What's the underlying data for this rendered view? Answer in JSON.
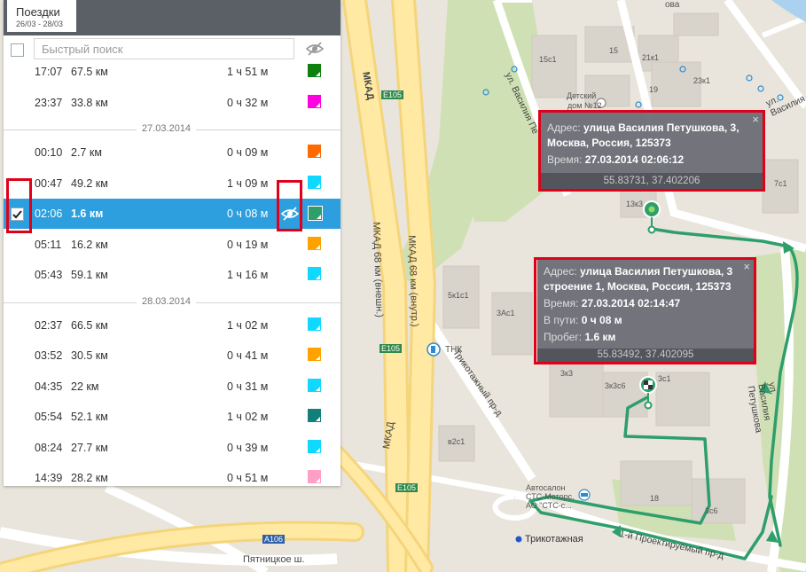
{
  "panel": {
    "tab_title": "Поездки",
    "tab_date": "26/03 - 28/03",
    "search_placeholder": "Быстрый поиск"
  },
  "list": {
    "partial_row": {
      "time": "17:07",
      "distance": "67.5 км",
      "duration": "1 ч 51 м",
      "color": "#0f7f0f"
    },
    "groups": [
      {
        "date": null,
        "rows": [
          {
            "time": "23:37",
            "distance": "33.8 км",
            "duration": "0 ч 32 м",
            "color": "#ff00e0"
          }
        ]
      },
      {
        "date": "27.03.2014",
        "rows": [
          {
            "time": "00:10",
            "distance": "2.7 км",
            "duration": "0 ч 09 м",
            "color": "#ff6a00"
          },
          {
            "time": "00:47",
            "distance": "49.2 км",
            "duration": "1 ч 09 м",
            "color": "#10d8ff"
          },
          {
            "time": "02:06",
            "distance": "1.6 км",
            "duration": "0 ч 08 м",
            "color": "#2e9e6a",
            "selected": true
          },
          {
            "time": "05:11",
            "distance": "16.2 км",
            "duration": "0 ч 19 м",
            "color": "#ffa200"
          },
          {
            "time": "05:43",
            "distance": "59.1 км",
            "duration": "1 ч 16 м",
            "color": "#10d8ff"
          }
        ]
      },
      {
        "date": "28.03.2014",
        "rows": [
          {
            "time": "02:37",
            "distance": "66.5 км",
            "duration": "1 ч 02 м",
            "color": "#10d8ff"
          },
          {
            "time": "03:52",
            "distance": "30.5 км",
            "duration": "0 ч 41 м",
            "color": "#ffa200"
          },
          {
            "time": "04:35",
            "distance": "22 км",
            "duration": "0 ч 31 м",
            "color": "#10d8ff"
          },
          {
            "time": "05:54",
            "distance": "52.1 км",
            "duration": "1 ч 02 м",
            "color": "#11807a"
          },
          {
            "time": "08:24",
            "distance": "27.7 км",
            "duration": "0 ч 39 м",
            "color": "#10d8ff"
          },
          {
            "time": "14:39",
            "distance": "28.2 км",
            "duration": "0 ч 51 м",
            "color": "#ff9fc8"
          }
        ]
      }
    ]
  },
  "popups": {
    "start": {
      "address_label": "Адрес:",
      "address_line1": "улица Василия Петушкова, 3,",
      "address_line2": "Москва, Россия, 125373",
      "time_label": "Время:",
      "time_value": "27.03.2014 02:06:12",
      "coords": "55.83731, 37.402206",
      "close": "×"
    },
    "end": {
      "address_label": "Адрес:",
      "address_line1": "улица Василия Петушкова, 3",
      "address_line2": "строение 1, Москва, Россия, 125373",
      "time_label": "Время:",
      "time_value": "27.03.2014 02:14:47",
      "enroute_label": "В пути:",
      "enroute_value": "0 ч 08 м",
      "mileage_label": "Пробег:",
      "mileage_value": "1.6 км",
      "coords": "55.83492, 37.402095",
      "close": "×"
    }
  },
  "map_labels": {
    "mkad": "МКАД",
    "mkad_outer": "МКАД 68 км (внешн.)",
    "mkad_inner": "МКАД 68 км (внутр.)",
    "mkad_bottom": "МКАД",
    "e105_1": "E105",
    "e105_2": "E105",
    "e105_3": "E105",
    "a106": "A106",
    "pyatnitskoe": "Пятницкое ш.",
    "trikotazh_road": "Трикотажный пр-д",
    "street_right": "ул. Василия",
    "street_right2": "ул. Василия Петушкова",
    "street_top": "ул. Василия Пе",
    "street_bottom": "1-й Проектируемый пр-д",
    "tnk": "ТНК",
    "metro": "Трикотажная",
    "kindergarten_1": "Детский",
    "kindergarten_2": "дом №12",
    "autosalon_1": "Автосалон",
    "autosalon_2": "СТС-Моторс,",
    "autosalon_3": "АО \"СТС-с...",
    "b_21k1": "21к1",
    "b_23k1": "23к1",
    "b_19": "19",
    "b_15": "15",
    "b_13k3": "13к3",
    "b_7c1": "7с1",
    "b_5kc1": "5к1с1",
    "b_3ac1": "3Ас1",
    "b_3k3": "3к3",
    "b_3k3c6": "3к3с6",
    "b_3c1": "3с1",
    "b_b2c1": "в2с1",
    "b_18": "18",
    "b_3c6": "3с6",
    "b_15c1": "15с1",
    "b_obo": "ова"
  }
}
